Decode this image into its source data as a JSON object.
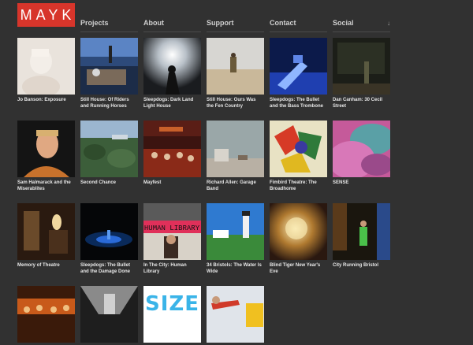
{
  "logo": "MAYK",
  "nav": [
    {
      "label": "Projects"
    },
    {
      "label": "About"
    },
    {
      "label": "Support"
    },
    {
      "label": "Contact"
    },
    {
      "label": "Social",
      "chevron": "↓"
    }
  ],
  "projects": [
    {
      "title": "Jo Banson: Exposure",
      "icon": "portrait-image"
    },
    {
      "title": "Still House: Of Riders and Running Horses",
      "icon": "stage-image"
    },
    {
      "title": "Sleepdogs: Dark Land Light House",
      "icon": "light-figure-image"
    },
    {
      "title": "Still House: Ours Was the Fen Country",
      "icon": "field-figure-image"
    },
    {
      "title": "Sleepdogs: The Bullet and the Bass Trombone",
      "icon": "blue-stage-image"
    },
    {
      "title": "Dan Canham: 30 Cecil Street",
      "icon": "dark-room-image"
    },
    {
      "title": "Sam Halmarack and the Miserablites",
      "icon": "face-portrait-image"
    },
    {
      "title": "Second Chance",
      "icon": "trees-image"
    },
    {
      "title": "Mayfest",
      "icon": "audience-image"
    },
    {
      "title": "Richard Allen: Garage Band",
      "icon": "pale-room-image"
    },
    {
      "title": "Fimbird Theatre: The Broadhome",
      "icon": "colorful-art-image"
    },
    {
      "title": "SENSE",
      "icon": "pink-smoke-image"
    },
    {
      "title": "Memory of Theatre",
      "icon": "interior-image"
    },
    {
      "title": "Sleepdogs: The Bullet and the Damage Done",
      "icon": "dark-blue-image"
    },
    {
      "title": "In The City: Human Library",
      "icon": "library-image"
    },
    {
      "title": "34 Bristols: The Water Is Wide",
      "icon": "lighthouse-image"
    },
    {
      "title": "Blind Tiger New Year's Eve",
      "icon": "blurred-light-image"
    },
    {
      "title": "City Running Bristol",
      "icon": "night-street-image"
    },
    {
      "title": "",
      "icon": "crowd-image"
    },
    {
      "title": "",
      "icon": "corridor-image"
    },
    {
      "title": "",
      "icon": "size-text-image",
      "text": "SIZE"
    },
    {
      "title": "",
      "icon": "red-figure-image"
    }
  ]
}
